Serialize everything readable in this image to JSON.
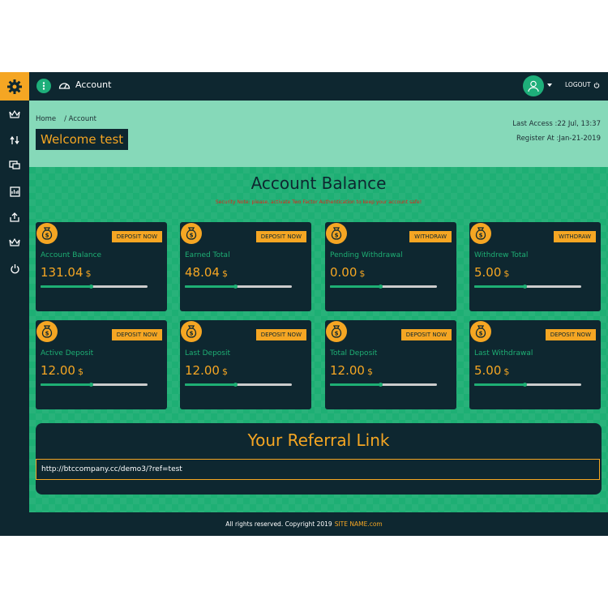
{
  "topbar": {
    "title": "Account",
    "logout_label": "LOGOUT",
    "icons": {
      "menu": "menu-dots-icon",
      "title": "dashboard-gauge-icon",
      "user": "user-icon",
      "power": "power-icon"
    }
  },
  "sidebar": {
    "top_icon": "gear-icon",
    "items": [
      {
        "icon": "crown-icon"
      },
      {
        "icon": "transfer-arrows-icon"
      },
      {
        "icon": "monitor-icon"
      },
      {
        "icon": "statement-icon"
      },
      {
        "icon": "share-icon"
      },
      {
        "icon": "crown-icon"
      },
      {
        "icon": "power-icon"
      }
    ]
  },
  "header": {
    "breadcrumb": [
      "Home",
      "/ Account"
    ],
    "welcome": "Welcome test",
    "last_access": "Last Access :22 Jul, 13:37",
    "register_at": "Register At :Jan-21-2019"
  },
  "balance": {
    "title": "Account Balance",
    "note": "Security Note: please, activate Two Factor Authentication to keep your account safe!",
    "cards": [
      {
        "label": "Account Balance",
        "value": "131.04",
        "unit": "$",
        "button": "DEPOSIT NOW",
        "progress": 0.47
      },
      {
        "label": "Earned Total",
        "value": "48.04",
        "unit": "$",
        "button": "DEPOSIT NOW",
        "progress": 0.47
      },
      {
        "label": "Pending Withdrawal",
        "value": "0.00",
        "unit": "$",
        "button": "WITHDRAW",
        "progress": 0.47
      },
      {
        "label": "Withdrew Total",
        "value": "5.00",
        "unit": "$",
        "button": "WITHDRAW",
        "progress": 0.47
      },
      {
        "label": "Active Deposit",
        "value": "12.00",
        "unit": "$",
        "button": "DEPOSIT NOW",
        "progress": 0.47
      },
      {
        "label": "Last Deposit",
        "value": "12.00",
        "unit": "$",
        "button": "DEPOSIT NOW",
        "progress": 0.47
      },
      {
        "label": "Total Deposit",
        "value": "12.00",
        "unit": "$",
        "button": "DEPOSIT NOW",
        "progress": 0.47
      },
      {
        "label": "Last Withdrawal",
        "value": "5.00",
        "unit": "$",
        "button": "DEPOSIT NOW",
        "progress": 0.47
      }
    ]
  },
  "referral": {
    "title": "Your Referral Link",
    "link": "http://btccompany.cc/demo3/?ref=test"
  },
  "footer": {
    "text": "All rights reserved. Copyright 2019",
    "site": "SITE NAME.com"
  },
  "colors": {
    "accent": "#f5a623",
    "green": "#1eaf74",
    "dark": "#0e2730",
    "light_green": "#86d9b9"
  }
}
